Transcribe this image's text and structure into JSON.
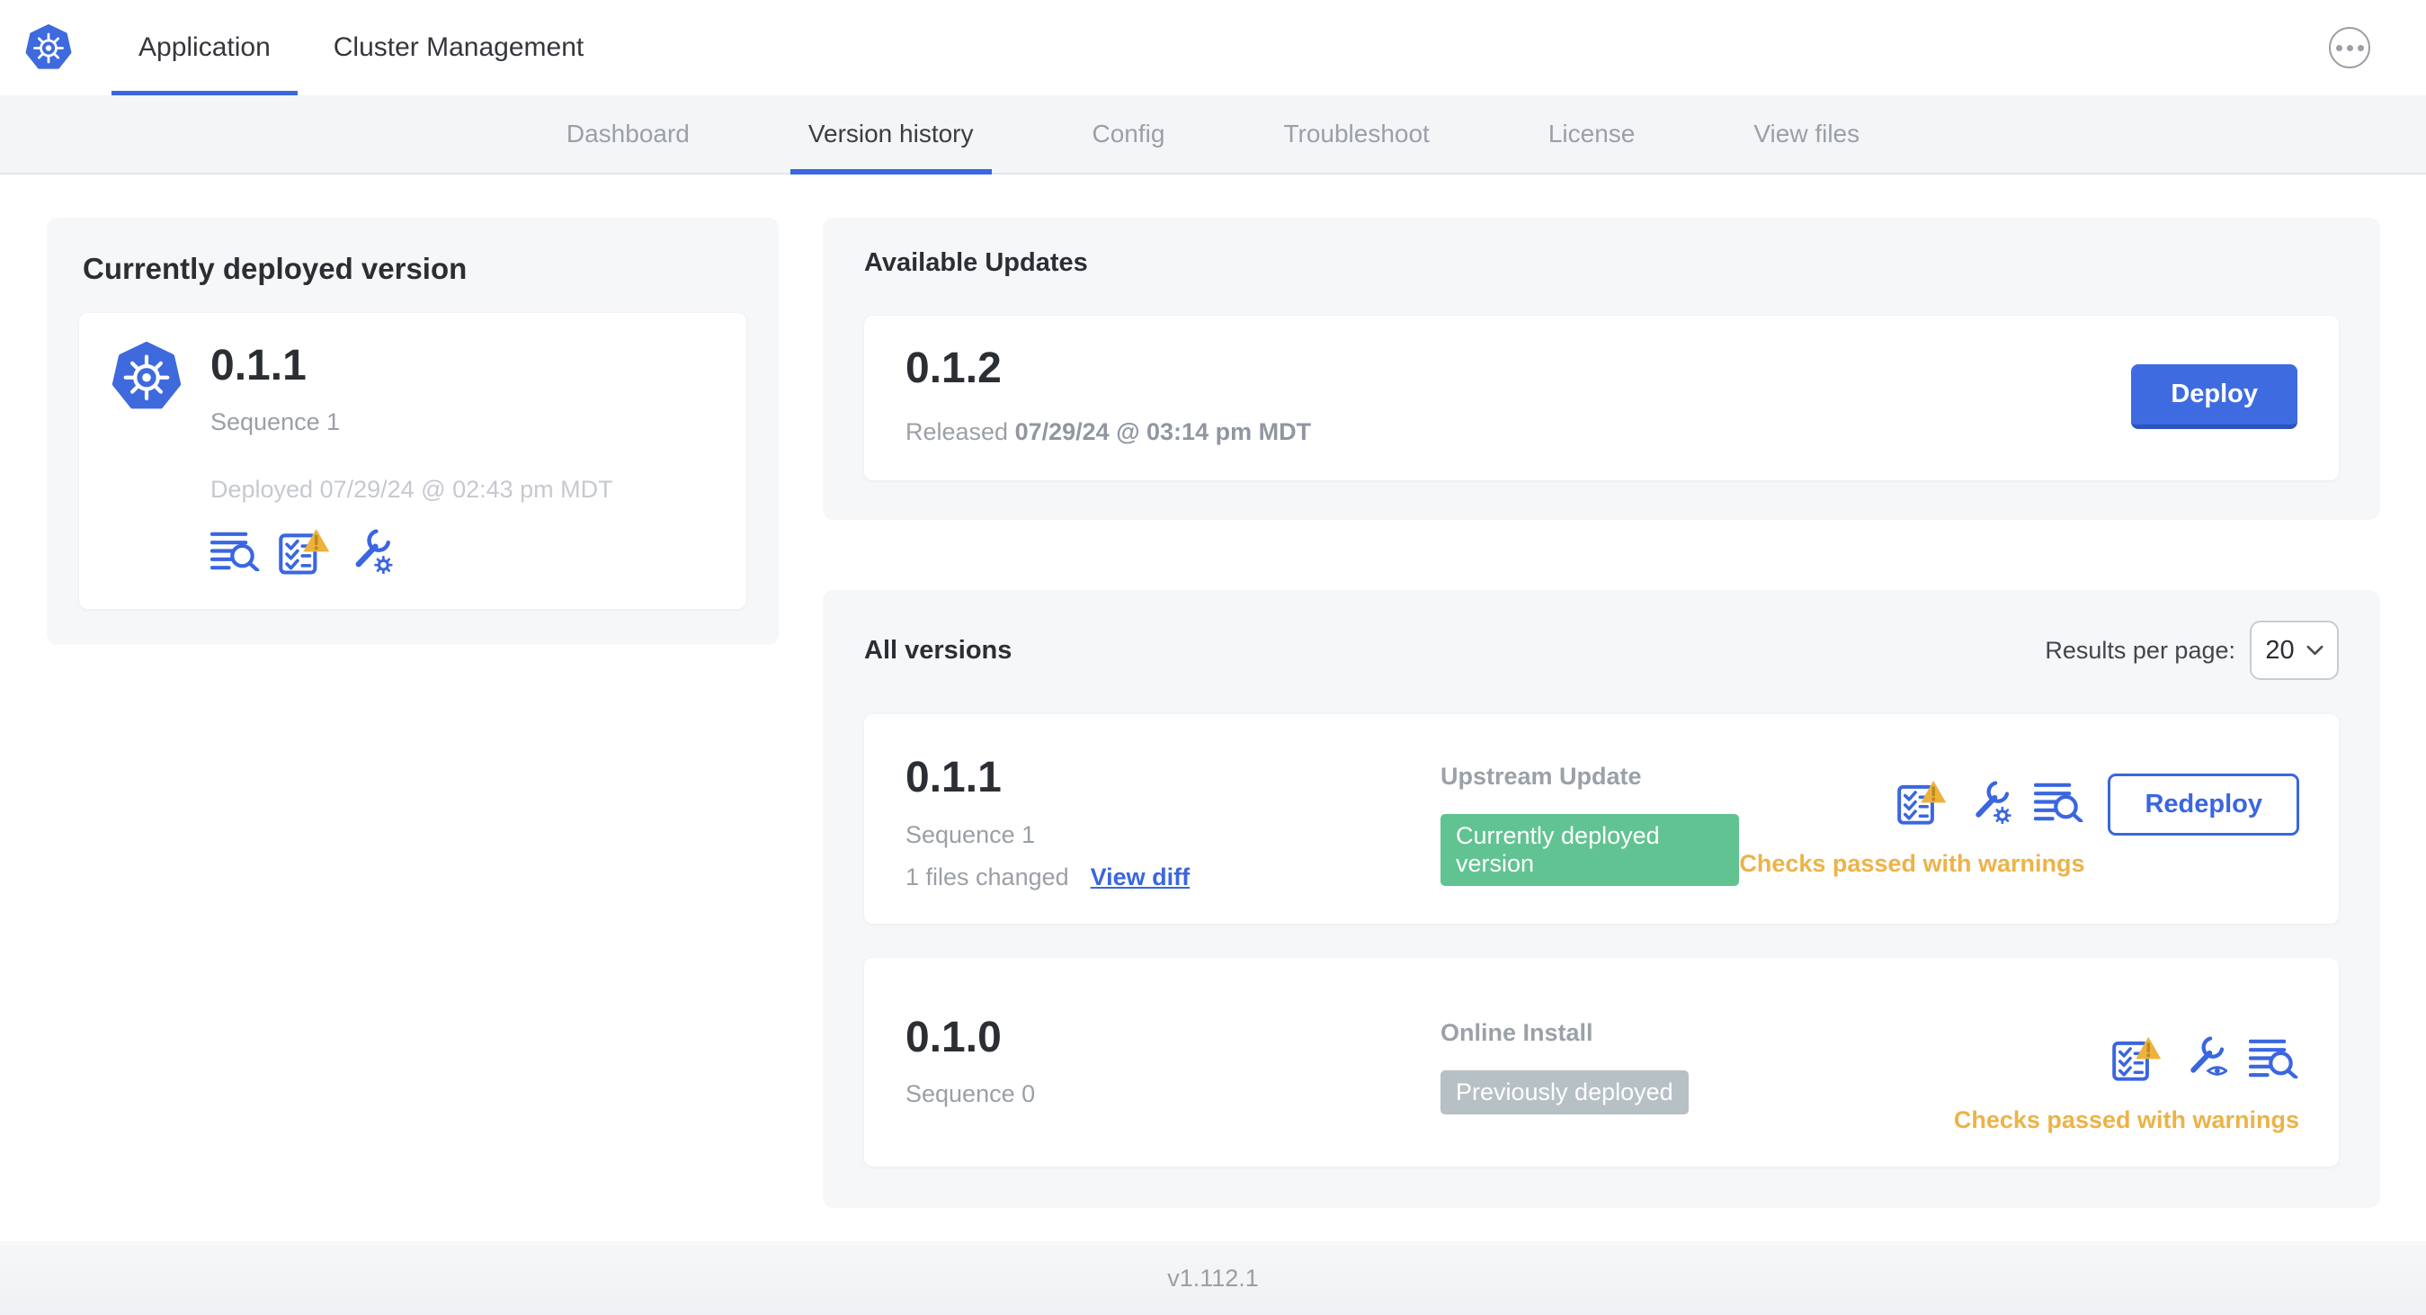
{
  "header": {
    "tabs": [
      {
        "label": "Application",
        "active": true
      },
      {
        "label": "Cluster Management",
        "active": false
      }
    ]
  },
  "nav": {
    "tabs": [
      {
        "label": "Dashboard",
        "active": false
      },
      {
        "label": "Version history",
        "active": true
      },
      {
        "label": "Config",
        "active": false
      },
      {
        "label": "Troubleshoot",
        "active": false
      },
      {
        "label": "License",
        "active": false
      },
      {
        "label": "View files",
        "active": false
      }
    ]
  },
  "currently_deployed": {
    "title": "Currently deployed version",
    "version": "0.1.1",
    "sequence": "Sequence 1",
    "deployed_at": "Deployed 07/29/24 @ 02:43 pm MDT",
    "icons": [
      "logs",
      "preflight-checks-warning",
      "edit-config"
    ]
  },
  "available_updates": {
    "title": "Available Updates",
    "version": "0.1.2",
    "released_prefix": "Released",
    "released_at": "07/29/24 @ 03:14 pm MDT",
    "deploy_label": "Deploy"
  },
  "all_versions": {
    "title": "All versions",
    "results_per_page_label": "Results per page:",
    "results_per_page_value": "20",
    "rows": [
      {
        "version": "0.1.1",
        "sequence": "Sequence 1",
        "files_changed": "1 files changed",
        "view_diff_label": "View diff",
        "source_type": "Upstream Update",
        "badge": {
          "label": "Currently deployed version",
          "color": "#61c392"
        },
        "icons": [
          "preflight-checks-warning",
          "edit-config",
          "logs"
        ],
        "action_label": "Redeploy",
        "status_text": "Checks passed with warnings"
      },
      {
        "version": "0.1.0",
        "sequence": "Sequence 0",
        "source_type": "Online Install",
        "badge": {
          "label": "Previously deployed",
          "color": "#b7c0c4"
        },
        "icons": [
          "preflight-checks-warning",
          "view-config",
          "logs"
        ],
        "status_text": "Checks passed with warnings"
      }
    ]
  },
  "footer": {
    "app_version": "v1.112.1"
  },
  "colors": {
    "accent_blue": "#3a66e0",
    "kubernetes_blue": "#3e6add",
    "success_green": "#61c392",
    "neutral_badge_gray": "#b7c0c4",
    "warning_amber": "#ecb347"
  }
}
